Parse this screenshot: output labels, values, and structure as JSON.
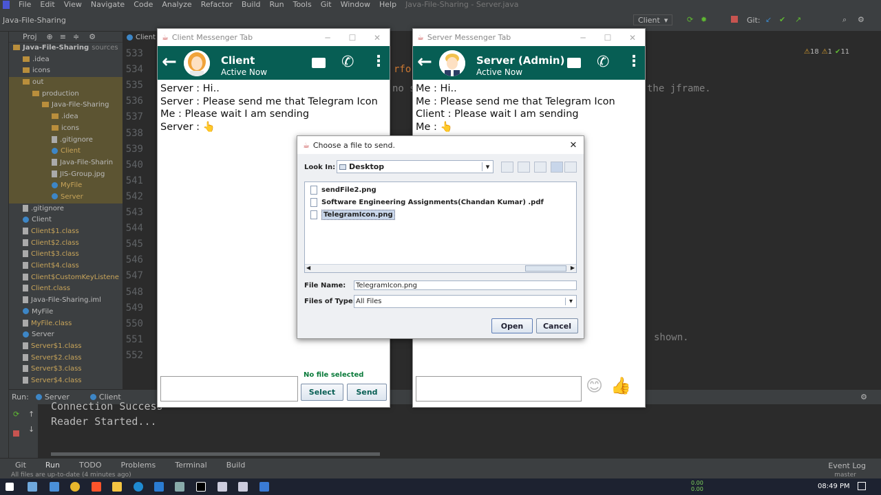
{
  "ide": {
    "menu": [
      "File",
      "Edit",
      "View",
      "Navigate",
      "Code",
      "Analyze",
      "Refactor",
      "Build",
      "Run",
      "Tools",
      "Git",
      "Window",
      "Help"
    ],
    "window_title": "Java-File-Sharing - Server.java",
    "project_name": "Java-File-Sharing",
    "run_config": "Client",
    "git_label": "Git:",
    "project_header": "Proj"
  },
  "tree": [
    {
      "label": "Java-File-Sharing",
      "suffix": "sources",
      "kind": "folder",
      "indent": 0
    },
    {
      "label": ".idea",
      "kind": "folder",
      "indent": 1
    },
    {
      "label": "icons",
      "kind": "folder",
      "indent": 1
    },
    {
      "label": "out",
      "kind": "folder",
      "indent": 1
    },
    {
      "label": "production",
      "kind": "folder",
      "indent": 2
    },
    {
      "label": "Java-File-Sharing",
      "kind": "folder",
      "indent": 3
    },
    {
      "label": ".idea",
      "kind": "folder",
      "indent": 4
    },
    {
      "label": "icons",
      "kind": "folder",
      "indent": 4
    },
    {
      "label": ".gitignore",
      "kind": "file",
      "indent": 4
    },
    {
      "label": "Client",
      "kind": "class",
      "indent": 4,
      "yellow": true
    },
    {
      "label": "Java-File-Sharin",
      "kind": "file",
      "indent": 4
    },
    {
      "label": "JIS-Group.jpg",
      "kind": "file",
      "indent": 4
    },
    {
      "label": "MyFile",
      "kind": "class",
      "indent": 4,
      "yellow": true
    },
    {
      "label": "Server",
      "kind": "class",
      "indent": 4,
      "yellow": true
    },
    {
      "label": ".gitignore",
      "kind": "file",
      "indent": 1
    },
    {
      "label": "Client",
      "kind": "class",
      "indent": 1
    },
    {
      "label": "Client$1.class",
      "kind": "file",
      "indent": 1,
      "yellow": true
    },
    {
      "label": "Client$2.class",
      "kind": "file",
      "indent": 1,
      "yellow": true
    },
    {
      "label": "Client$3.class",
      "kind": "file",
      "indent": 1,
      "yellow": true
    },
    {
      "label": "Client$4.class",
      "kind": "file",
      "indent": 1,
      "yellow": true
    },
    {
      "label": "Client$CustomKeyListene",
      "kind": "file",
      "indent": 1,
      "yellow": true
    },
    {
      "label": "Client.class",
      "kind": "file",
      "indent": 1,
      "yellow": true
    },
    {
      "label": "Java-File-Sharing.iml",
      "kind": "file",
      "indent": 1
    },
    {
      "label": "MyFile",
      "kind": "class",
      "indent": 1
    },
    {
      "label": "MyFile.class",
      "kind": "file",
      "indent": 1,
      "yellow": true
    },
    {
      "label": "Server",
      "kind": "class",
      "indent": 1
    },
    {
      "label": "Server$1.class",
      "kind": "file",
      "indent": 1,
      "yellow": true
    },
    {
      "label": "Server$2.class",
      "kind": "file",
      "indent": 1,
      "yellow": true
    },
    {
      "label": "Server$3.class",
      "kind": "file",
      "indent": 1,
      "yellow": true
    },
    {
      "label": "Server$4.class",
      "kind": "file",
      "indent": 1,
      "yellow": true
    }
  ],
  "editor": {
    "tab_client": "Client",
    "line_numbers": [
      "533",
      "534",
      "535",
      "536",
      "537",
      "538",
      "539",
      "540",
      "541",
      "542",
      "543",
      "544",
      "545",
      "546",
      "547",
      "548",
      "549",
      "550",
      "551",
      "552"
    ],
    "code_fragment_1": "rfor",
    "code_fragment_2": "no s",
    "code_fragment_3": "the jframe.",
    "code_fragment_4": "shown.",
    "inspections": {
      "warnings": "18",
      "errors": "1",
      "weak": "11"
    }
  },
  "run": {
    "label": "Run:",
    "tabs": [
      "Server",
      "Client"
    ],
    "console": [
      "Connection Success",
      "Reader Started..."
    ]
  },
  "bottom_tabs": [
    "Git",
    "Run",
    "TODO",
    "Problems",
    "Terminal",
    "Build"
  ],
  "event_log": "Event Log",
  "status": {
    "message": "All files are up-to-date (4 minutes ago)",
    "branch": "master"
  },
  "taskbar": {
    "time": "08:49 PM",
    "net_up": "0.00",
    "net_down": "0.00"
  },
  "client_window": {
    "title": "Client Messenger Tab",
    "name": "Client",
    "status": "Active Now",
    "messages": [
      "Server : Hi..",
      "Server : Please send me that Telegram Icon",
      "Me : Please wait I am sending",
      "Server : 👆"
    ],
    "file_status": "No file selected",
    "select_label": "Select",
    "send_label": "Send"
  },
  "server_window": {
    "title": "Server Messenger Tab",
    "name": "Server (Admin)",
    "status": "Active Now",
    "messages": [
      "Me : Hi..",
      "Me : Please send me that Telegram Icon",
      "Client : Please wait I am sending",
      "Me : 👆"
    ],
    "emoji_smile": "😊",
    "emoji_thumb": "👍"
  },
  "dialog": {
    "title": "Choose a file to send.",
    "look_in_label": "Look In:",
    "look_in_value": "Desktop",
    "files": [
      "sendFile2.png",
      "Software Engineering Assignments(Chandan Kumar) .pdf",
      "TelegramIcon.png"
    ],
    "selected_index": 2,
    "file_name_label": "File Name:",
    "file_name_value": "TelegramIcon.png",
    "files_of_type_label": "Files of Type:",
    "files_of_type_value": "All Files",
    "open_label": "Open",
    "cancel_label": "Cancel"
  },
  "colors": {
    "header_green": "#075e54",
    "ide_bg": "#2b2b2b",
    "ide_panel": "#3c3f41"
  }
}
